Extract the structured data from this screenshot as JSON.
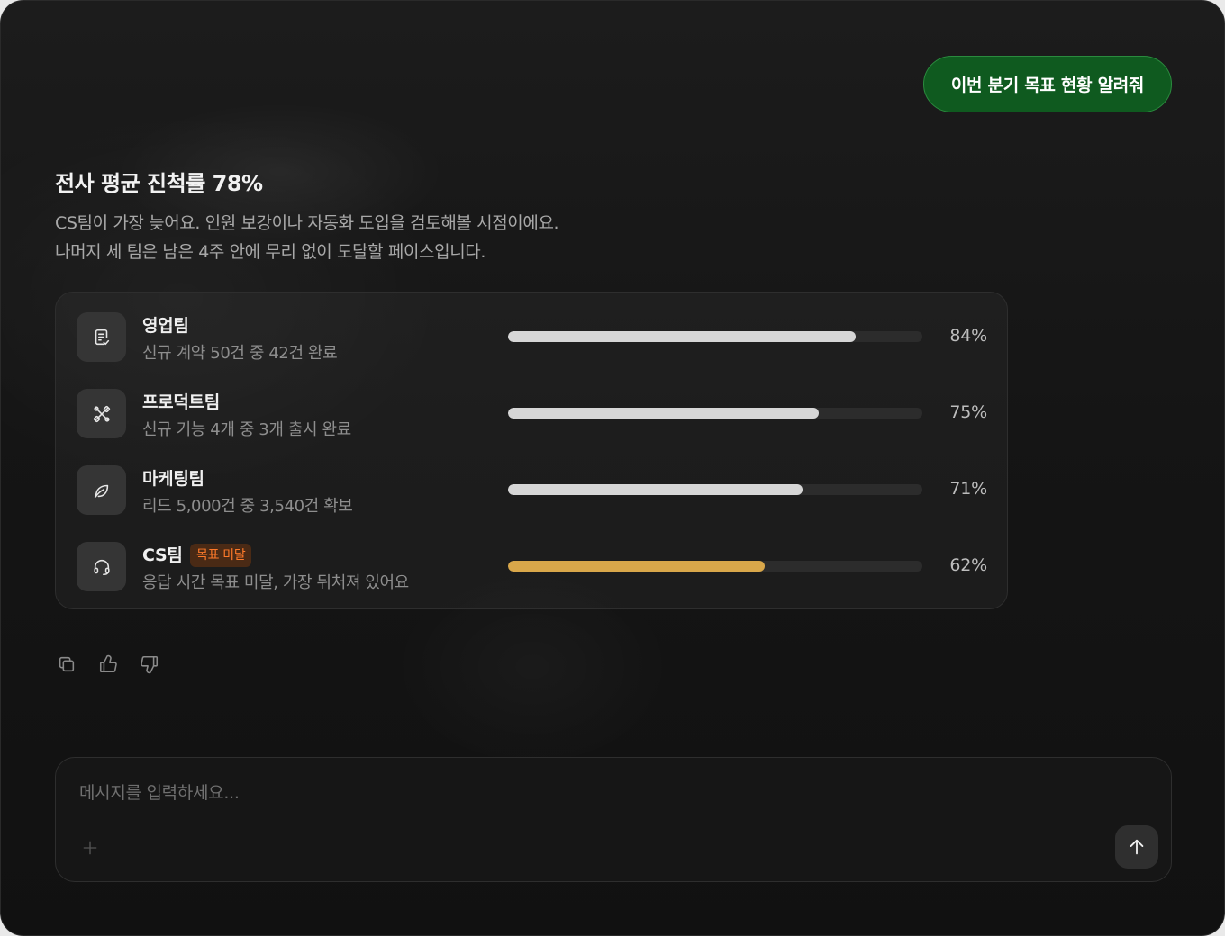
{
  "chat": {
    "user_message": "이번 분기 목표 현황 알려줘"
  },
  "response": {
    "headline": "전사 평균 진척률 78%",
    "paragraph_line1": "CS팀이 가장 늦어요. 인원 보강이나 자동화 도입을 검토해볼 시점이에요.",
    "paragraph_line2": "나머지 세 팀은 남은 4주 안에 무리 없이 도달할 페이스입니다."
  },
  "teams": [
    {
      "name": "영업팀",
      "desc": "신규 계약 50건 중 42건 완료",
      "percent_label": "84%",
      "progress": 0.84,
      "icon": "clipboard-check-icon",
      "badge": null
    },
    {
      "name": "프로덕트팀",
      "desc": "신규 기능 4개 중 3개 출시 완료",
      "percent_label": "75%",
      "progress": 0.75,
      "icon": "wrench-tools-icon",
      "badge": null
    },
    {
      "name": "마케팅팀",
      "desc": "리드 5,000건 중 3,540건 확보",
      "percent_label": "71%",
      "progress": 0.71,
      "icon": "leaf-icon",
      "badge": null
    },
    {
      "name": "CS팀",
      "desc": "응답 시간 목표 미달, 가장 뒤처져 있어요",
      "percent_label": "62%",
      "progress": 0.62,
      "icon": "headset-icon",
      "badge": "목표 미달"
    }
  ],
  "colors": {
    "accent_green": "#0f5a1f",
    "bar_fill": "#d6d6d6",
    "bar_warn": "#d9a74a",
    "badge_text": "#ff7a2a"
  },
  "actions": {
    "icons": [
      "copy-icon",
      "thumbs-up-icon",
      "thumbs-down-icon"
    ]
  },
  "composer": {
    "placeholder": "메시지를 입력하세요...",
    "value": ""
  }
}
